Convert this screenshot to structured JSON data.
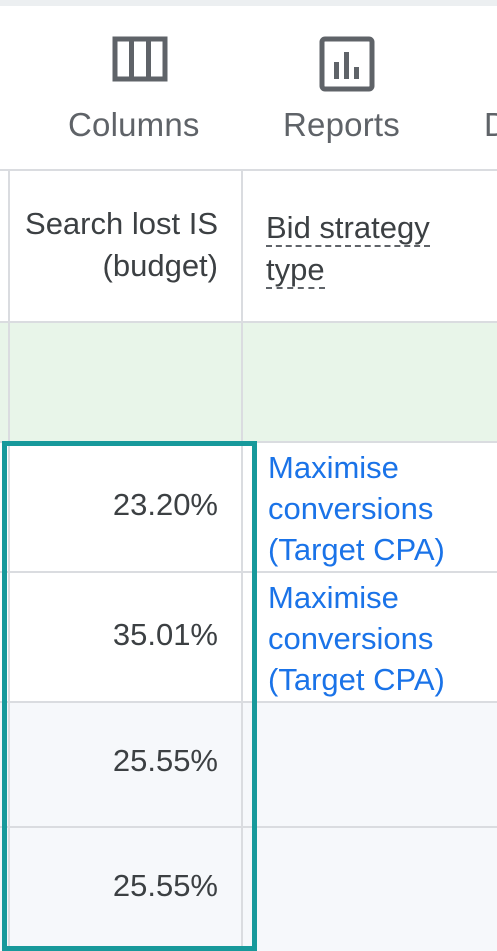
{
  "toolbar": {
    "columns_label": "Columns",
    "reports_label": "Reports",
    "cut_label": "D",
    "columns_icon": "columns-icon",
    "reports_icon": "bar-chart-icon"
  },
  "table": {
    "headers": {
      "search_lost_is": "Search lost IS (budget)",
      "bid_strategy_line1": "Bid strategy",
      "bid_strategy_line2": "type"
    },
    "rows": [
      {
        "search_lost_is": "23.20%",
        "bid_strategy": "Maximise conversions (Target CPA)"
      },
      {
        "search_lost_is": "35.01%",
        "bid_strategy": "Maximise conversions (Target CPA)"
      },
      {
        "search_lost_is": "25.55%",
        "bid_strategy": ""
      },
      {
        "search_lost_is": "25.55%",
        "bid_strategy": ""
      }
    ]
  },
  "colors": {
    "accent_highlight": "#17999b",
    "link": "#1a73e8",
    "total_row": "#e8f5e9"
  }
}
